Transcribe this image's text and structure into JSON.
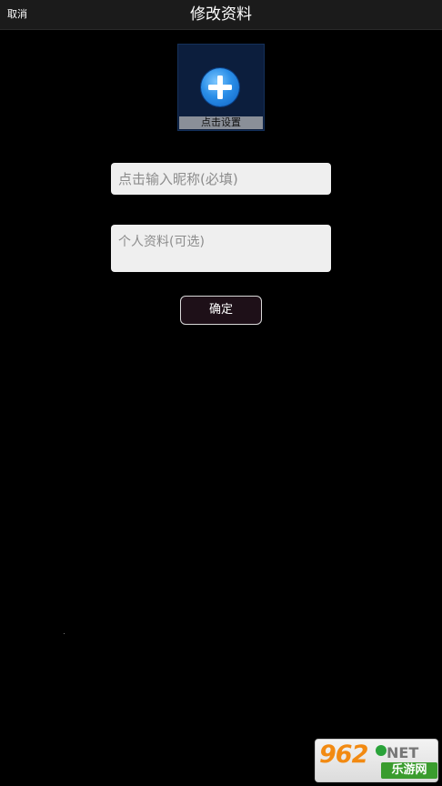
{
  "header": {
    "cancel_label": "取消",
    "title": "修改资料"
  },
  "avatar": {
    "icon": "plus-circle-icon",
    "caption": "点击设置"
  },
  "form": {
    "nickname_placeholder": "点击输入昵称(必填)",
    "nickname_value": "",
    "profile_placeholder": "个人资料(可选)",
    "profile_value": "",
    "confirm_label": "确定"
  },
  "watermark": {
    "number": "962",
    "suffix": "NET",
    "site_name": "乐游网"
  },
  "colors": {
    "background": "#000000",
    "header_bg": "#1b1b1b",
    "input_bg": "#efefef",
    "accent_blue": "#2a8ee8"
  }
}
